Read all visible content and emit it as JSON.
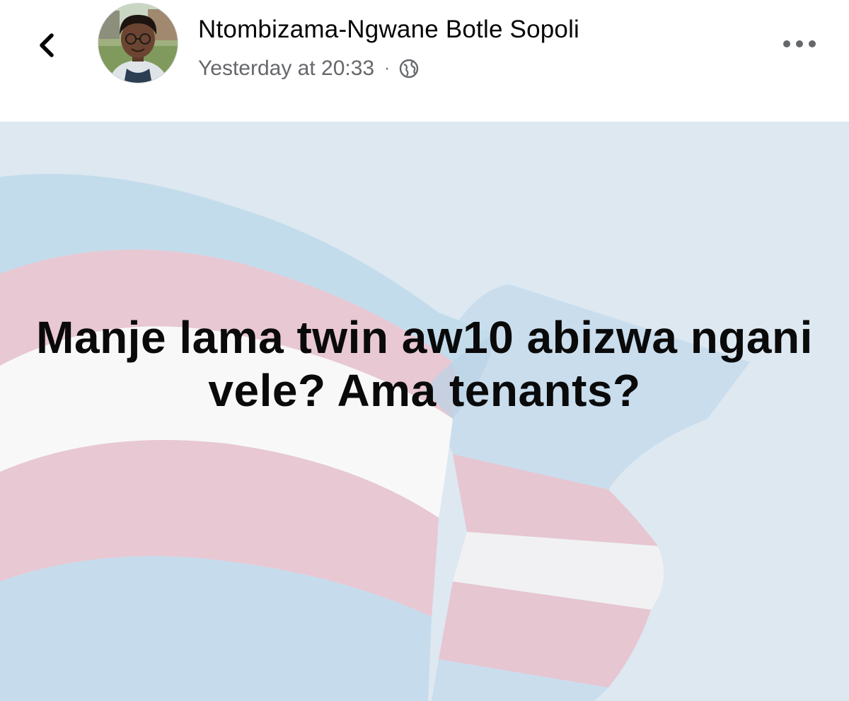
{
  "post_header": {
    "author_name": "Ntombizama-Ngwane Botle Sopoli",
    "timestamp": "Yesterday at 20:33",
    "separator": "·",
    "audience_icon": "globe-icon",
    "back_icon": "chevron-left-icon",
    "more_icon": "more-horizontal-icon"
  },
  "post": {
    "text": "Manje lama twin aw10 abizwa ngani vele? Ama tenants?",
    "background_colors": {
      "sky": "#dde8f1",
      "blue_stripe": "#c3dcec",
      "pink_stripe": "#e8c8d3",
      "white_stripe": "#f8f8f9"
    }
  },
  "colors": {
    "name_text": "#050505",
    "meta_text": "#65676b",
    "post_text": "#0a0a0a"
  }
}
